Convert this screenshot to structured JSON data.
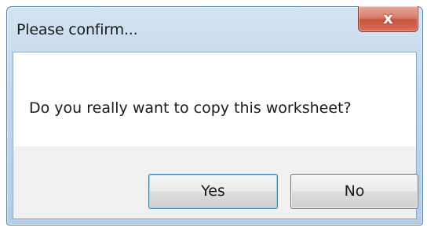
{
  "window": {
    "title": "Please confirm...",
    "close_icon": "close-icon",
    "close_glyph": "x"
  },
  "dialog": {
    "message": "Do you really want to copy this worksheet?"
  },
  "buttons": {
    "yes_label": "Yes",
    "no_label": "No"
  },
  "colors": {
    "close_button": "#d2705a",
    "titlebar": "#c2d6eb",
    "focused_button_border": "#3c7fb1"
  }
}
